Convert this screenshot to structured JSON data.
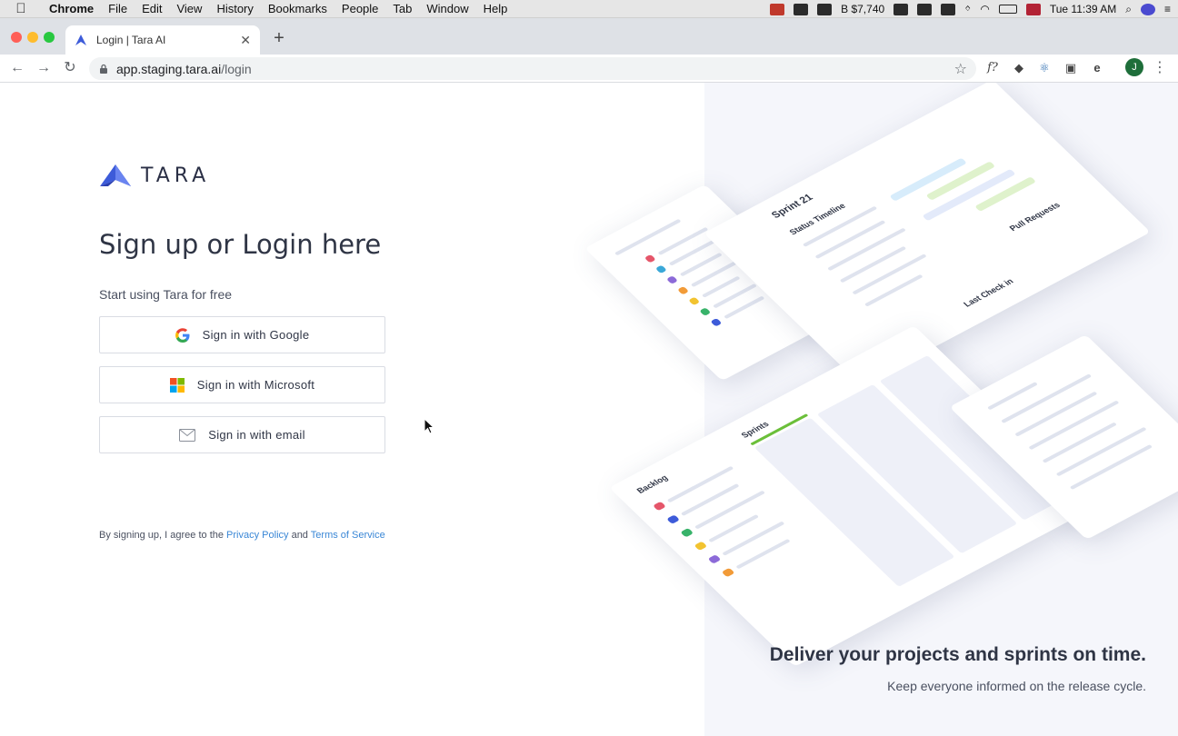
{
  "menubar": {
    "app": "Chrome",
    "items": [
      "File",
      "Edit",
      "View",
      "History",
      "Bookmarks",
      "People",
      "Tab",
      "Window",
      "Help"
    ],
    "status_price": "B $7,740",
    "clock": "Tue 11:39 AM"
  },
  "browser": {
    "tab_title": "Login | Tara AI",
    "url_host": "app.staging.tara.ai",
    "url_path": "/login",
    "extension_f": "f?",
    "extension_e": "e",
    "profile_initial": "J"
  },
  "page": {
    "logo_text": "TARA",
    "heading": "Sign up or Login here",
    "subheading": "Start using Tara for free",
    "buttons": {
      "google": "Sign in with Google",
      "microsoft": "Sign in with Microsoft",
      "email": "Sign in with email"
    },
    "terms": {
      "prefix": "By signing up, I agree to the ",
      "privacy": "Privacy Policy",
      "and": " and ",
      "tos": "Terms of Service"
    },
    "tagline": "Deliver your projects and sprints on time.",
    "tagline_sub": "Keep everyone informed on the release cycle.",
    "illustration_labels": {
      "sprint": "Sprint 21",
      "timeline": "Status Timeline",
      "backlog": "Backlog",
      "sprints": "Sprints",
      "pull_requests": "Pull Requests",
      "last_checkin": "Last Check in"
    }
  },
  "colors": {
    "brand_blue": "#3d5bd9",
    "link": "#3a87d6",
    "panel_bg": "#f5f6fb"
  }
}
